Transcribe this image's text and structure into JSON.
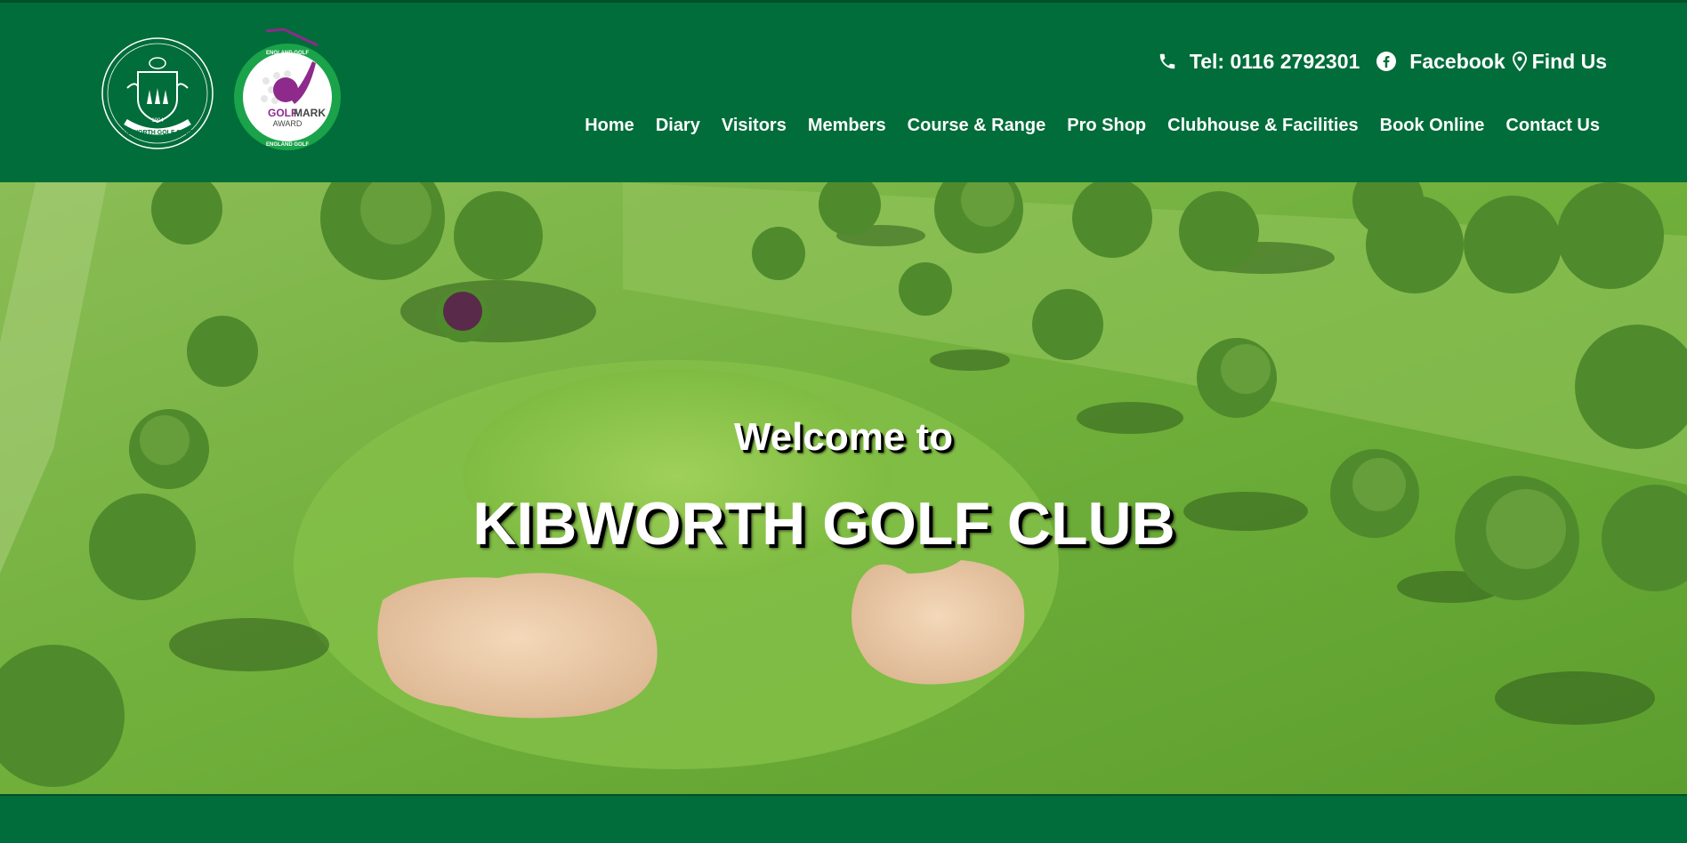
{
  "logos": {
    "crest": {
      "year": "1904",
      "ring_text": "KIBWORTH GOLF CLUB"
    },
    "golfmark": {
      "top_text": "ENGLAND GOLF",
      "brand_a": "GOLF",
      "brand_b": "MARK",
      "award": "AWARD",
      "bottom_text": "ENGLAND GOLF"
    }
  },
  "utility": {
    "phone": "Tel: 0116 2792301",
    "facebook": "Facebook",
    "find_us": "Find Us"
  },
  "nav": {
    "items": [
      {
        "label": "Home"
      },
      {
        "label": "Diary"
      },
      {
        "label": "Visitors"
      },
      {
        "label": "Members"
      },
      {
        "label": "Course & Range"
      },
      {
        "label": "Pro Shop"
      },
      {
        "label": "Clubhouse & Facilities"
      },
      {
        "label": "Book Online"
      },
      {
        "label": "Contact Us"
      }
    ]
  },
  "hero": {
    "welcome": "Welcome to",
    "title": "KIBWORTH GOLF CLUB"
  },
  "colors": {
    "brand_green": "#006d3a",
    "fairway": "#6fae3a",
    "bunker_sand": "#e9c9a6",
    "golfmark_purple": "#8e2a8c"
  }
}
